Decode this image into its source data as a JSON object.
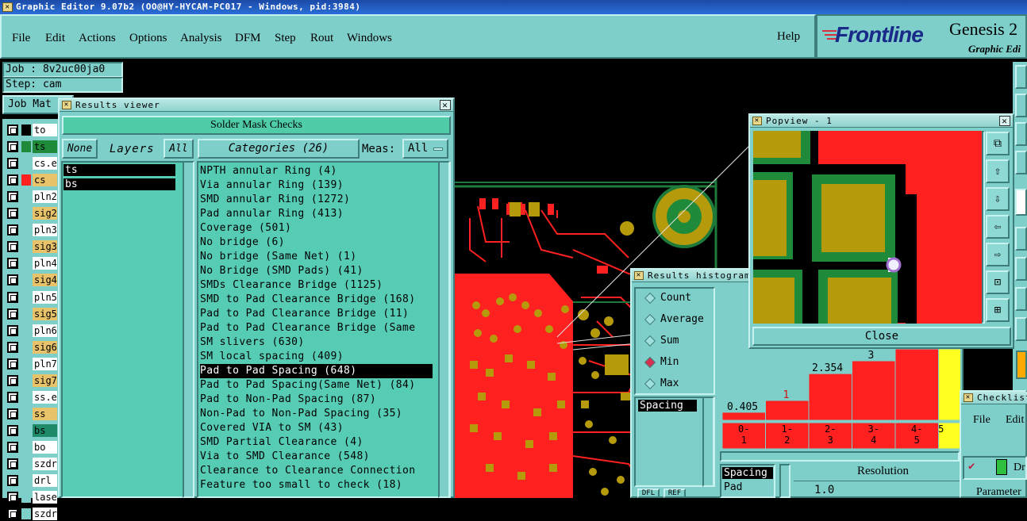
{
  "window_title": "Graphic Editor 9.07b2 (OO@HY-HYCAM-PC017 - Windows, pid:3984)",
  "menu": [
    "File",
    "Edit",
    "Actions",
    "Options",
    "Analysis",
    "DFM",
    "Step",
    "Rout",
    "Windows"
  ],
  "help": "Help",
  "brand": {
    "logo": "Frontline",
    "product": "Genesis 2",
    "subtitle": "Graphic Edi"
  },
  "job": {
    "job_label": "Job : 8v2uc00ja0",
    "step_label": "Step: cam",
    "matrix_label": "Job Mat"
  },
  "layers": [
    {
      "name": "to",
      "swatch": "#000000",
      "nbg": "#ffffff"
    },
    {
      "name": "ts",
      "swatch": "#1e8a3a",
      "nbg": "#1e8a3a"
    },
    {
      "name": "cs.e",
      "swatch": "#7ececa",
      "nbg": "#ffffff"
    },
    {
      "name": "cs",
      "swatch": "#ff2020",
      "nbg": "#e8c36a"
    },
    {
      "name": "pln2",
      "swatch": "#7ececa",
      "nbg": "#ffffff"
    },
    {
      "name": "sig2",
      "swatch": "#7ececa",
      "nbg": "#e8c36a"
    },
    {
      "name": "pln3",
      "swatch": "#7ececa",
      "nbg": "#ffffff"
    },
    {
      "name": "sig3",
      "swatch": "#7ececa",
      "nbg": "#e8c36a"
    },
    {
      "name": "pln4",
      "swatch": "#7ececa",
      "nbg": "#ffffff"
    },
    {
      "name": "sig4",
      "swatch": "#7ececa",
      "nbg": "#e8c36a"
    },
    {
      "name": "pln5",
      "swatch": "#7ececa",
      "nbg": "#ffffff"
    },
    {
      "name": "sig5",
      "swatch": "#7ececa",
      "nbg": "#e8c36a"
    },
    {
      "name": "pln6",
      "swatch": "#7ececa",
      "nbg": "#ffffff"
    },
    {
      "name": "sig6",
      "swatch": "#7ececa",
      "nbg": "#e8c36a"
    },
    {
      "name": "pln7",
      "swatch": "#7ececa",
      "nbg": "#ffffff"
    },
    {
      "name": "sig7",
      "swatch": "#7ececa",
      "nbg": "#e8c36a"
    },
    {
      "name": "ss.e",
      "swatch": "#7ececa",
      "nbg": "#ffffff"
    },
    {
      "name": "ss",
      "swatch": "#7ececa",
      "nbg": "#e8c36a"
    },
    {
      "name": "bs",
      "swatch": "#7ececa",
      "nbg": "#1e8a6a"
    },
    {
      "name": "bo",
      "swatch": "#7ececa",
      "nbg": "#ffffff"
    },
    {
      "name": "szdr",
      "swatch": "#7ececa",
      "nbg": "#ffffff"
    },
    {
      "name": "drl",
      "swatch": "#7ececa",
      "nbg": "#ffffff"
    },
    {
      "name": "lase",
      "swatch": "#7ececa",
      "nbg": "#ffffff"
    },
    {
      "name": "szdr",
      "swatch": "#7ececa",
      "nbg": "#ffffff"
    }
  ],
  "results_viewer": {
    "title": "Results viewer",
    "header": "Solder Mask Checks",
    "none_btn": "None",
    "layers_label": "Layers",
    "all_btn": "All",
    "categories_label": "Categories (26)",
    "meas_label": "Meas:",
    "meas_value": "All",
    "layer_list": [
      "ts",
      "bs"
    ],
    "categories": [
      "NPTH annular Ring (4)",
      "Via annular Ring (139)",
      "SMD annular Ring (1272)",
      "Pad annular Ring (413)",
      "Coverage (501)",
      "No bridge (6)",
      "No bridge (Same Net) (1)",
      "No Bridge (SMD Pads) (41)",
      "SMDs Clearance Bridge (1125)",
      "SMD to Pad Clearance Bridge (168)",
      "Pad to Pad Clearance Bridge (11)",
      "Pad to Pad Clearance Bridge (Same",
      "SM slivers (630)",
      "SM local spacing (409)",
      "Pad to Pad Spacing (648)",
      "Pad to Pad Spacing(Same Net) (84)",
      "Pad to Non-Pad Spacing (87)",
      "Non-Pad to Non-Pad Spacing (35)",
      "Covered VIA to SM (43)",
      "SMD Partial Clearance (4)",
      "Via to SMD Clearance (548)",
      "Clearance to Clearance Connection",
      "Feature too small to check (18)"
    ],
    "selected_index": 14
  },
  "popview": {
    "title": "Popview - 1",
    "close": "Close"
  },
  "histogram": {
    "title": "Results histogram",
    "modes": [
      "Count",
      "Average",
      "Sum",
      "Min",
      "Max"
    ],
    "selected_mode": "Min",
    "list_item": "Spacing",
    "list2": [
      "Spacing",
      "Pad"
    ],
    "resolution_label": "Resolution",
    "resolution_value": "1.0",
    "bins": [
      "0-\n1",
      "1-\n2",
      "2-\n3",
      "3-\n4",
      "4-\n5",
      "5"
    ],
    "bin_values": [
      0.405,
      1,
      2.354,
      3,
      3.6,
      3.6
    ],
    "value_labels": [
      "0.405",
      "1",
      "2.354",
      "3",
      "",
      ""
    ],
    "bottom_btns": [
      "DFL",
      "REF"
    ]
  },
  "checklist": {
    "title": "Checklist",
    "menu": [
      "File",
      "Edit"
    ],
    "item": "Dr",
    "param": "Parameter"
  },
  "colors": {
    "teal": "#7ececa",
    "red": "#ff2020",
    "gold": "#b59b0c",
    "green": "#1e8a3a",
    "yellow": "#ffff20"
  }
}
